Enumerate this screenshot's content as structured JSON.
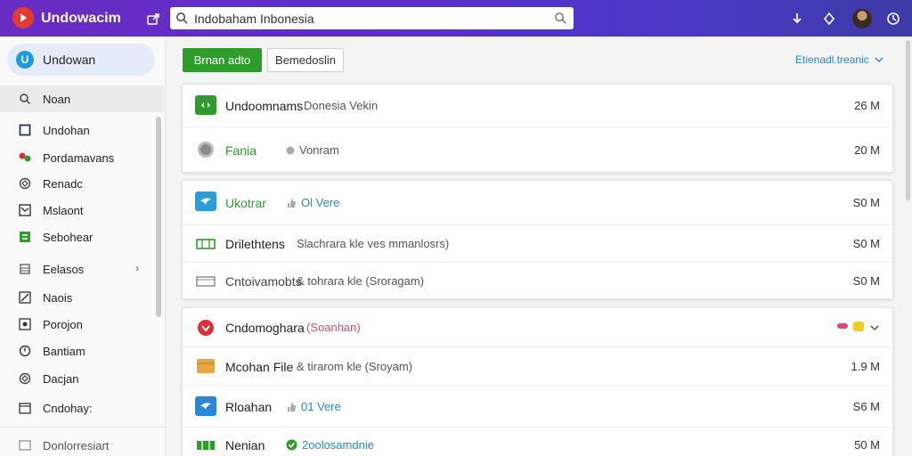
{
  "app": {
    "title": "Undowacim"
  },
  "search": {
    "value": "Indobaham Inbonesia"
  },
  "sidebar": {
    "top_item": {
      "badge": "U",
      "label": "Undowan"
    },
    "items": [
      {
        "label": "Noan",
        "icon": "search-icon",
        "active": true
      },
      {
        "label": "Undohan",
        "icon": "file-icon"
      },
      {
        "label": "Pordamavans",
        "icon": "people-icon"
      },
      {
        "label": "Renadc",
        "icon": "globe-icon"
      },
      {
        "label": "Mslaont",
        "icon": "chart-icon"
      },
      {
        "label": "Sebohear",
        "icon": "grid-icon"
      },
      {
        "label": "Eelasos",
        "icon": "layers-icon",
        "has_chevron": true
      },
      {
        "label": "Naois",
        "icon": "pen-icon"
      },
      {
        "label": "Porojon",
        "icon": "image-icon"
      },
      {
        "label": "Bantiam",
        "icon": "clock-icon"
      },
      {
        "label": "Dacjan",
        "icon": "globe-icon"
      },
      {
        "label": "Cndohay:",
        "icon": "calendar-icon"
      },
      {
        "label": "Donlorresiart",
        "icon": "folder-icon"
      }
    ]
  },
  "toolbar": {
    "primary_label": "Brnan adto",
    "secondary_label": "Bemedoslin",
    "sort_label": "Etienadl.treanic"
  },
  "cards": [
    {
      "rows": [
        {
          "name": "Undoomnams",
          "sep": ":",
          "meta": "Donesia Vekin",
          "size": "26 M",
          "icon": "arrows-icon",
          "icon_color": "#2e9d2c"
        },
        {
          "name": "Fania",
          "name_color": "green",
          "meta": "Vonram",
          "meta_icon": "dot-icon",
          "size": "20 M",
          "icon": "circle-icon"
        }
      ]
    },
    {
      "rows": [
        {
          "name": "Ukotrar",
          "name_color": "green",
          "meta": "Ol Vere",
          "meta_color": "blue",
          "meta_icon": "thumb-icon",
          "size": "S0 M",
          "icon": "bird-icon",
          "icon_color": "#2a9ed9"
        },
        {
          "name": "Drilethtens",
          "meta": "Slachrara kle ves mmanlosrs)",
          "size": "S0 M",
          "icon": "frame-icon",
          "icon_color": "#2e9d2c"
        },
        {
          "name": "Cntoivamobts",
          "name_color": "gray",
          "meta": "& tohrara kle (Sroragam)",
          "size": "S0 M",
          "icon": "frame-icon",
          "icon_color": "#888888"
        }
      ]
    },
    {
      "rows": [
        {
          "name": "Cndomoghara",
          "meta": "(Soanhan)",
          "meta_color": "pink",
          "size": "",
          "icon": "heart-icon",
          "icon_color": "#d9303a",
          "trailing": true
        },
        {
          "name": "Mcohan File",
          "meta": "& tirarom kle (Sroyam)",
          "size": "1.9 M",
          "icon": "folder-icon",
          "icon_color": "#e8a545"
        },
        {
          "name": "Rloahan",
          "meta": "01 Vere",
          "meta_color": "blue",
          "meta_icon": "thumb-icon",
          "size": "S6 M",
          "icon": "bird-icon",
          "icon_color": "#2a86d6"
        },
        {
          "name": "Nenian",
          "meta": "2oolosamdnie",
          "meta_color": "blue",
          "meta_icon": "check-icon",
          "size": "50 M",
          "icon": "frame-icon",
          "icon_color": "#2e9d2c"
        }
      ]
    }
  ],
  "colors": {
    "header_start": "#6a2cc4",
    "header_end": "#3e3aa6",
    "accent_green": "#2e9d2c",
    "accent_blue": "#2a86d6"
  }
}
